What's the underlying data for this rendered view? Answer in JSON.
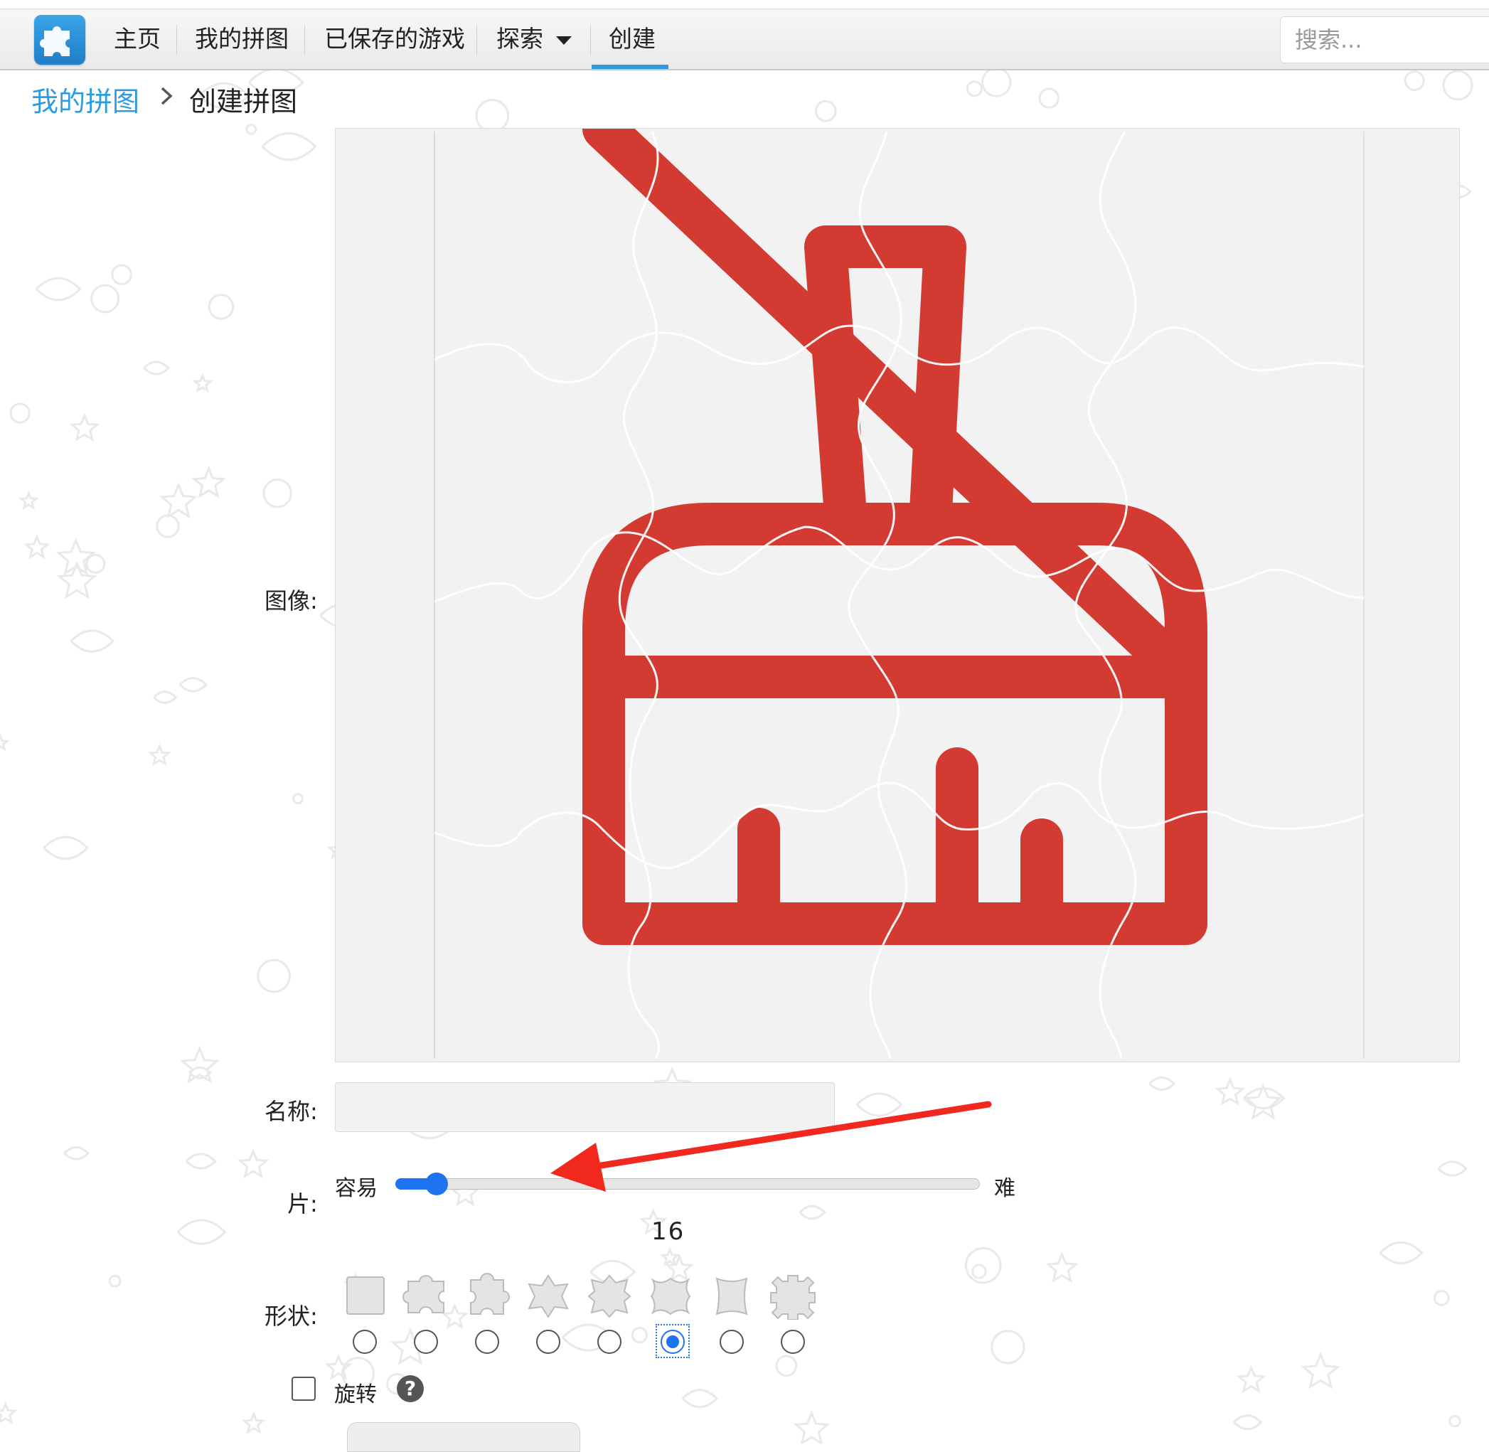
{
  "nav": {
    "home": "主页",
    "my_puzzles": "我的拼图",
    "saved_games": "已保存的游戏",
    "explore": "探索",
    "create": "创建",
    "search_placeholder": "搜索..."
  },
  "breadcrumb": {
    "parent": "我的拼图",
    "current": "创建拼图"
  },
  "form": {
    "image_label": "图像:",
    "name_label": "名称:",
    "name_value": "",
    "pieces_label": "片:",
    "easy_label": "容易",
    "hard_label": "难",
    "pieces_count": "16",
    "difficulty_fraction": 0.07,
    "shape_label": "形状:",
    "shapes_count": 8,
    "selected_shape_index": 5,
    "rotate_label": "旋转",
    "rotate_checked": false,
    "help_symbol": "?"
  },
  "colors": {
    "accent": "#2e9be0",
    "slider": "#1e74f0",
    "brush_red": "#d33a31",
    "annotation_arrow": "#f0281e"
  },
  "icons": {
    "logo": "puzzle-piece-icon",
    "breadcrumb_separator": "chevron-right-icon",
    "explore_dropdown": "caret-down-icon",
    "preview_subject": "brush-icon",
    "help": "question-mark-icon"
  }
}
